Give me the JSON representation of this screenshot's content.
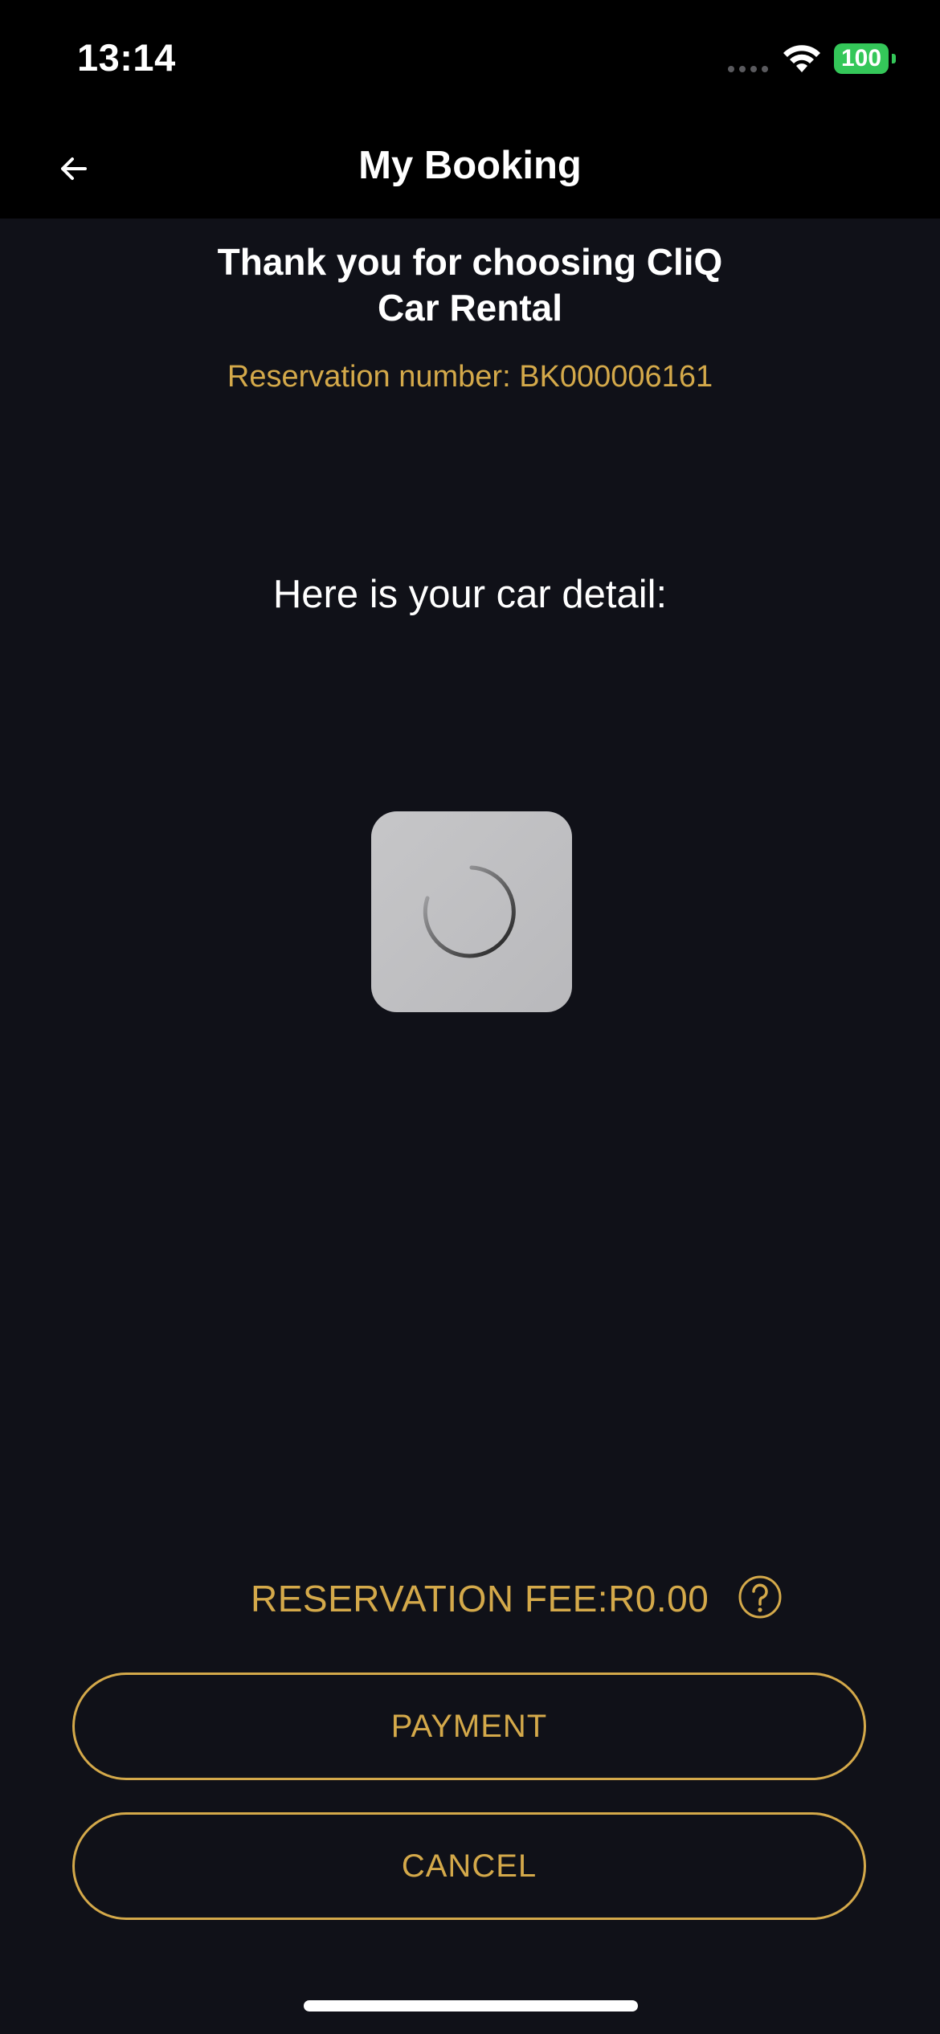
{
  "status_bar": {
    "time": "13:14",
    "battery": "100",
    "signal_icon": "cellular-signal-icon",
    "wifi_icon": "wifi-icon"
  },
  "header": {
    "title": "My Booking",
    "back_icon": "arrow-left-icon"
  },
  "booking": {
    "thanks_line1": "Thank you for choosing CliQ",
    "thanks_line2": "Car Rental",
    "reservation_number": "Reservation number: BK000006161",
    "car_detail_heading": "Here is your car detail:"
  },
  "loader": {
    "icon": "loading-spinner-icon"
  },
  "fee": {
    "text": "RESERVATION FEE:R0.00",
    "help_icon": "question-circle-icon"
  },
  "actions": {
    "payment_label": "PAYMENT",
    "cancel_label": "CANCEL"
  },
  "colors": {
    "background": "#101118",
    "header_background": "#000000",
    "accent_gold": "#d4a94a",
    "battery_green": "#34c759",
    "text_white": "#ffffff"
  }
}
